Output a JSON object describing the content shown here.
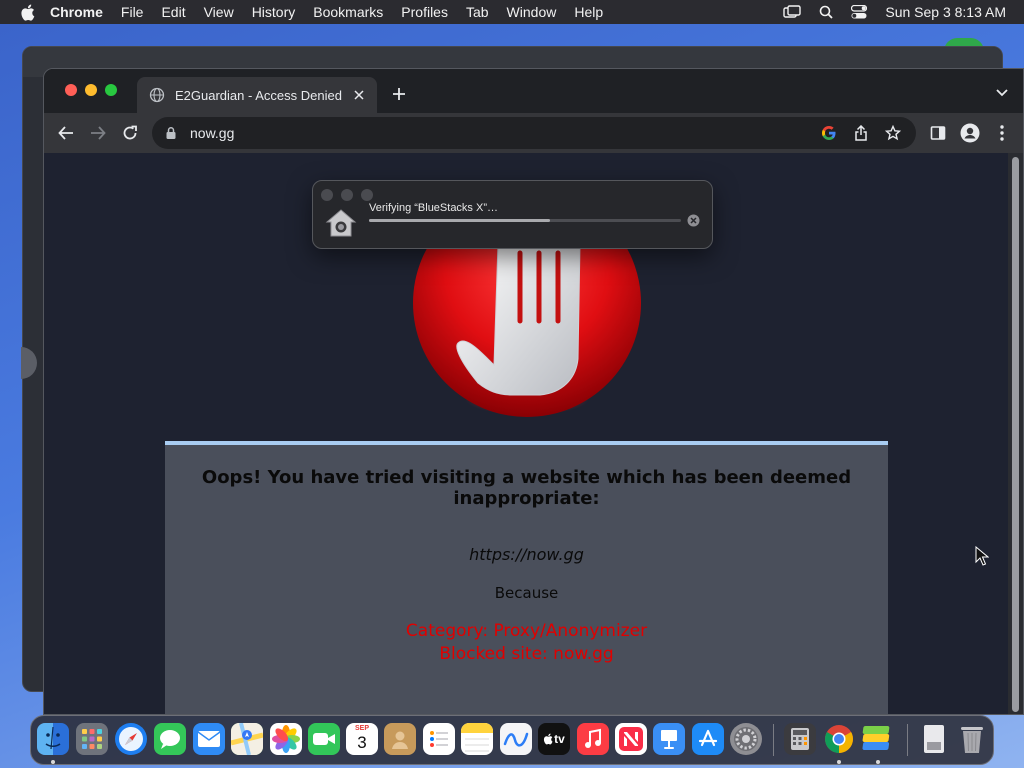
{
  "menubar": {
    "app_name": "Chrome",
    "items": [
      "File",
      "Edit",
      "View",
      "History",
      "Bookmarks",
      "Profiles",
      "Tab",
      "Window",
      "Help"
    ],
    "clock": "Sun Sep 3  8:13 AM"
  },
  "browser": {
    "tab_title": "E2Guardian - Access Denied",
    "url": "now.gg"
  },
  "verify_dialog": {
    "message": "Verifying “BlueStacks X”…",
    "progress": 0.58
  },
  "block_page": {
    "heading": "Oops! You have tried visiting a website which has been deemed inappropriate:",
    "blocked_url": "https://now.gg",
    "because": "Because",
    "category_line": "Category: Proxy/Anonymizer",
    "site_line": "Blocked site: now.gg"
  },
  "dock": {
    "calendar_month": "SEP",
    "calendar_day": "3",
    "tv_label": "tv"
  },
  "colors": {
    "block_reason": "#e00000",
    "panel_border": "#a9cdf2",
    "panel_bg": "#4a4f5b",
    "page_bg": "#1e2230"
  }
}
